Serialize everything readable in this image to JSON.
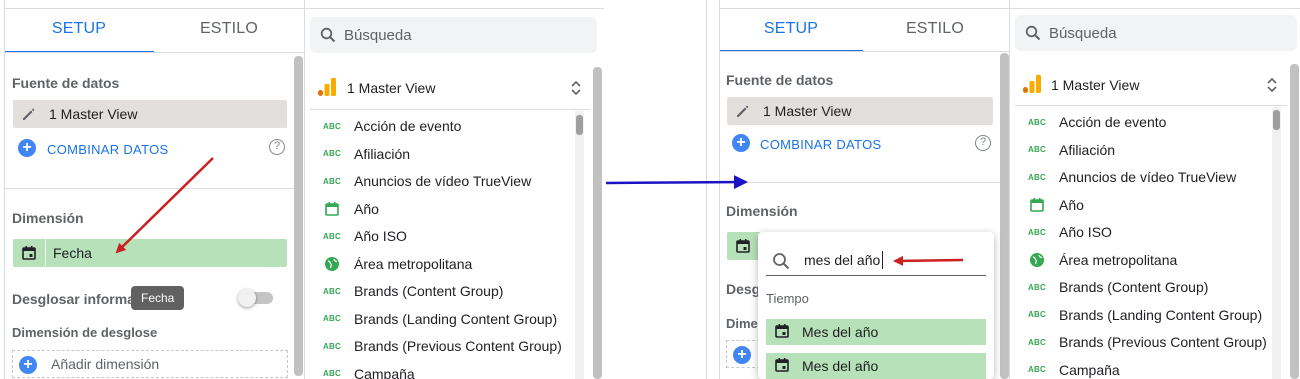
{
  "left_panel": {
    "tabs": {
      "setup": "SETUP",
      "style": "ESTILO"
    },
    "data_source_title": "Fuente de datos",
    "source_name": "1 Master View",
    "blend_label": "COMBINAR DATOS",
    "dimension_title": "Dimensión",
    "dimension_value": "Fecha",
    "tooltip": "Fecha",
    "drilldown_label": "Desglosar informac",
    "drilldown_dimension_title": "Dimensión de desglose",
    "add_dimension": "Añadir dimensión"
  },
  "left_fields": {
    "search_placeholder": "Búsqueda",
    "source_name": "1 Master View",
    "items": [
      {
        "icon": "abc",
        "label": "Acción de evento"
      },
      {
        "icon": "abc",
        "label": "Afiliación"
      },
      {
        "icon": "abc",
        "label": "Anuncios de vídeo TrueView"
      },
      {
        "icon": "calendar",
        "label": "Año"
      },
      {
        "icon": "abc",
        "label": "Año ISO"
      },
      {
        "icon": "globe",
        "label": "Área metropolitana"
      },
      {
        "icon": "abc",
        "label": "Brands (Content Group)"
      },
      {
        "icon": "abc",
        "label": "Brands (Landing Content Group)"
      },
      {
        "icon": "abc",
        "label": "Brands (Previous Content Group)"
      },
      {
        "icon": "abc",
        "label": "Campaña"
      }
    ]
  },
  "right_panel": {
    "tabs": {
      "setup": "SETUP",
      "style": "ESTILO"
    },
    "data_source_title": "Fuente de datos",
    "source_name": "1 Master View",
    "blend_label": "COMBINAR DATOS",
    "dimension_title": "Dimensión",
    "partial_desglo": "Desgl",
    "partial_dimen": "Dimen",
    "dropdown": {
      "search_value": "mes del año",
      "group_title": "Tiempo",
      "items": [
        "Mes del año",
        "Mes del año"
      ]
    }
  },
  "right_fields": {
    "search_placeholder": "Búsqueda",
    "source_name": "1 Master View",
    "items": [
      {
        "icon": "abc",
        "label": "Acción de evento"
      },
      {
        "icon": "abc",
        "label": "Afiliación"
      },
      {
        "icon": "abc",
        "label": "Anuncios de vídeo TrueView"
      },
      {
        "icon": "calendar",
        "label": "Año"
      },
      {
        "icon": "abc",
        "label": "Año ISO"
      },
      {
        "icon": "globe",
        "label": "Área metropolitana"
      },
      {
        "icon": "abc",
        "label": "Brands (Content Group)"
      },
      {
        "icon": "abc",
        "label": "Brands (Landing Content Group)"
      },
      {
        "icon": "abc",
        "label": "Brands (Previous Content Group)"
      },
      {
        "icon": "abc",
        "label": "Campaña"
      }
    ]
  },
  "icons": {
    "abc": "ABC",
    "edit": "pencil-icon",
    "calendar": "calendar-icon",
    "globe": "globe-icon",
    "search": "search-icon",
    "analytics": "analytics-icon",
    "chevron": "collapse-chevron-icon"
  },
  "colors": {
    "accent_blue": "#1a73e8",
    "dimension_green": "#b7e1b8",
    "source_gray": "#e2dfdc",
    "annotation_red": "#cc1f1f",
    "annotation_blue": "#1b14c4",
    "abc_green": "#34a853"
  }
}
